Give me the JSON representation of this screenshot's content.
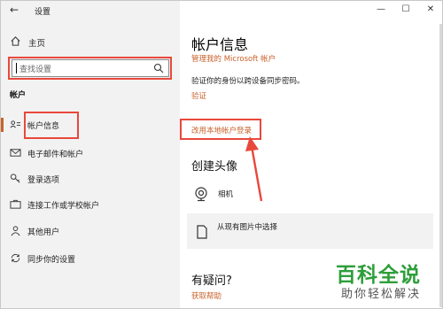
{
  "window": {
    "title": "设置"
  },
  "titlebar": {
    "minimize": "—",
    "maximize": "☐",
    "close": "✕"
  },
  "sidebar": {
    "home_label": "主页",
    "search_placeholder": "查找设置",
    "section_title": "帐户",
    "items": [
      {
        "label": "帐户信息",
        "icon": "account-info-icon",
        "active": true
      },
      {
        "label": "电子邮件和帐户",
        "icon": "mail-icon"
      },
      {
        "label": "登录选项",
        "icon": "key-icon"
      },
      {
        "label": "连接工作或学校帐户",
        "icon": "briefcase-icon"
      },
      {
        "label": "其他用户",
        "icon": "person-icon"
      },
      {
        "label": "同步你的设置",
        "icon": "sync-icon"
      }
    ]
  },
  "main": {
    "title": "帐户信息",
    "manage_ms_link": "管理我的 Microsoft 帐户",
    "verify_text": "验证你的身份以跨设备同步密码。",
    "verify_link": "验证",
    "local_account_link": "改用本地帐户登录",
    "avatar_section_title": "创建头像",
    "options": [
      {
        "label": "相机",
        "icon": "camera-icon"
      },
      {
        "label": "从现有图片中选择",
        "icon": "document-icon"
      }
    ],
    "help_title": "有疑问?",
    "help_link": "获取帮助"
  },
  "watermark": {
    "main": "百科全说",
    "sub": "助你轻松解决"
  },
  "colors": {
    "accent": "#c8622b",
    "highlight": "#e8483c",
    "sidebar_bg": "#f2f2f2",
    "watermark_green": "#2e9e3a"
  }
}
